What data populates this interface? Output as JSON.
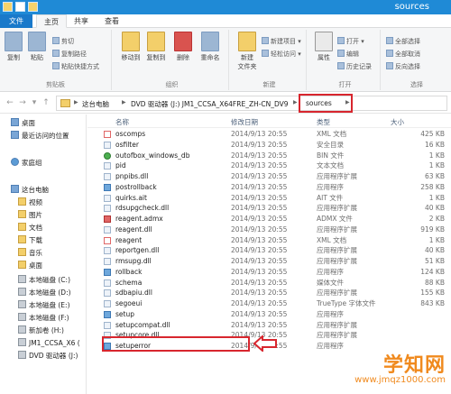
{
  "window": {
    "title": "sources"
  },
  "ribbon_tabs": [
    "文件",
    "主页",
    "共享",
    "查看"
  ],
  "ribbon": {
    "clipboard": {
      "label": "剪贴板",
      "copy": "复制",
      "paste": "粘贴",
      "cut": "剪切",
      "copy_path": "复制路径",
      "paste_shortcut": "粘贴快捷方式"
    },
    "organize": {
      "label": "组织",
      "move_to": "移动到",
      "copy_to": "复制到",
      "delete": "删除",
      "rename": "重命名"
    },
    "new": {
      "label": "新建",
      "new_folder": "新建\n文件夹",
      "new_item": "新建项目 ▾",
      "easy_access": "轻松访问 ▾"
    },
    "open": {
      "label": "打开",
      "properties": "属性",
      "open_btn": "打开 ▾",
      "edit": "编辑",
      "history": "历史记录"
    },
    "select": {
      "label": "选择",
      "select_all": "全部选择",
      "select_none": "全部取消",
      "invert": "反向选择"
    }
  },
  "address": {
    "crumbs": [
      "这台电脑",
      "DVD 驱动器 (J:) JM1_CCSA_X64FRE_ZH-CN_DV9",
      "sources"
    ]
  },
  "nav": {
    "items": [
      {
        "label": "桌面",
        "icon": "desktop-icon"
      },
      {
        "label": "最近访问的位置",
        "icon": "recent-icon"
      },
      {
        "label": "家庭组",
        "icon": "homegroup-icon"
      },
      {
        "label": "这台电脑",
        "icon": "computer-icon"
      },
      {
        "label": "视频",
        "icon": "folder-icon"
      },
      {
        "label": "图片",
        "icon": "folder-icon"
      },
      {
        "label": "文档",
        "icon": "folder-icon"
      },
      {
        "label": "下载",
        "icon": "folder-icon"
      },
      {
        "label": "音乐",
        "icon": "folder-icon"
      },
      {
        "label": "桌面",
        "icon": "folder-icon"
      },
      {
        "label": "本地磁盘 (C:)",
        "icon": "drive-icon"
      },
      {
        "label": "本地磁盘 (D:)",
        "icon": "drive-icon"
      },
      {
        "label": "本地磁盘 (E:)",
        "icon": "drive-icon"
      },
      {
        "label": "本地磁盘 (F:)",
        "icon": "drive-icon"
      },
      {
        "label": "新加卷 (H:)",
        "icon": "drive-icon"
      },
      {
        "label": "JM1_CCSA_X6 (",
        "icon": "drive-icon"
      },
      {
        "label": "DVD 驱动器 (J:)",
        "icon": "dvd-icon"
      }
    ]
  },
  "columns": {
    "name": "名称",
    "date": "修改日期",
    "type": "类型",
    "size": "大小"
  },
  "files": [
    {
      "name": "oscomps",
      "date": "2014/9/13 20:55",
      "type": "XML 文档",
      "size": "425 KB",
      "kind": "xml"
    },
    {
      "name": "osfilter",
      "date": "2014/9/13 20:55",
      "type": "安全目录",
      "size": "16 KB",
      "kind": "generic"
    },
    {
      "name": "outofbox_windows_db",
      "date": "2014/9/13 20:55",
      "type": "BIN 文件",
      "size": "1 KB",
      "kind": "db"
    },
    {
      "name": "pid",
      "date": "2014/9/13 20:55",
      "type": "文本文档",
      "size": "1 KB",
      "kind": "generic"
    },
    {
      "name": "pnpibs.dll",
      "date": "2014/9/13 20:55",
      "type": "应用程序扩展",
      "size": "63 KB",
      "kind": "generic"
    },
    {
      "name": "postrollback",
      "date": "2014/9/13 20:55",
      "type": "应用程序",
      "size": "258 KB",
      "kind": "exe"
    },
    {
      "name": "quirks.ait",
      "date": "2014/9/13 20:55",
      "type": "AIT 文件",
      "size": "1 KB",
      "kind": "generic"
    },
    {
      "name": "rdsupgcheck.dll",
      "date": "2014/9/13 20:55",
      "type": "应用程序扩展",
      "size": "40 KB",
      "kind": "generic"
    },
    {
      "name": "reagent.admx",
      "date": "2014/9/13 20:55",
      "type": "ADMX 文件",
      "size": "2 KB",
      "kind": "adm"
    },
    {
      "name": "reagent.dll",
      "date": "2014/9/13 20:55",
      "type": "应用程序扩展",
      "size": "919 KB",
      "kind": "generic"
    },
    {
      "name": "reagent",
      "date": "2014/9/13 20:55",
      "type": "XML 文档",
      "size": "1 KB",
      "kind": "xml"
    },
    {
      "name": "reportgen.dll",
      "date": "2014/9/13 20:55",
      "type": "应用程序扩展",
      "size": "40 KB",
      "kind": "generic"
    },
    {
      "name": "rmsupg.dll",
      "date": "2014/9/13 20:55",
      "type": "应用程序扩展",
      "size": "51 KB",
      "kind": "generic"
    },
    {
      "name": "rollback",
      "date": "2014/9/13 20:55",
      "type": "应用程序",
      "size": "124 KB",
      "kind": "exe"
    },
    {
      "name": "schema",
      "date": "2014/9/13 20:55",
      "type": "媒体文件",
      "size": "88 KB",
      "kind": "generic"
    },
    {
      "name": "sdbapiu.dll",
      "date": "2014/9/13 20:55",
      "type": "应用程序扩展",
      "size": "155 KB",
      "kind": "generic"
    },
    {
      "name": "segoeui",
      "date": "2014/9/13 20:55",
      "type": "TrueType 字体文件",
      "size": "843 KB",
      "kind": "generic"
    },
    {
      "name": "setup",
      "date": "2014/9/13 20:55",
      "type": "应用程序",
      "size": "",
      "kind": "exe"
    },
    {
      "name": "setupcompat.dll",
      "date": "2014/9/13 20:55",
      "type": "应用程序扩展",
      "size": "",
      "kind": "generic"
    },
    {
      "name": "setupcore.dll",
      "date": "2014/9/13 20:55",
      "type": "应用程序扩展",
      "size": "",
      "kind": "generic"
    },
    {
      "name": "setuperror",
      "date": "2014/9/13 20:55",
      "type": "应用程序",
      "size": "",
      "kind": "exe"
    }
  ],
  "watermark": {
    "main": "学知网",
    "sub": "www.jmqz1000.com"
  },
  "colors": {
    "title_bar": "#1f8ad6",
    "file_tab": "#1979ca",
    "highlight": "#d8262e",
    "watermark": "#f08a1e"
  }
}
